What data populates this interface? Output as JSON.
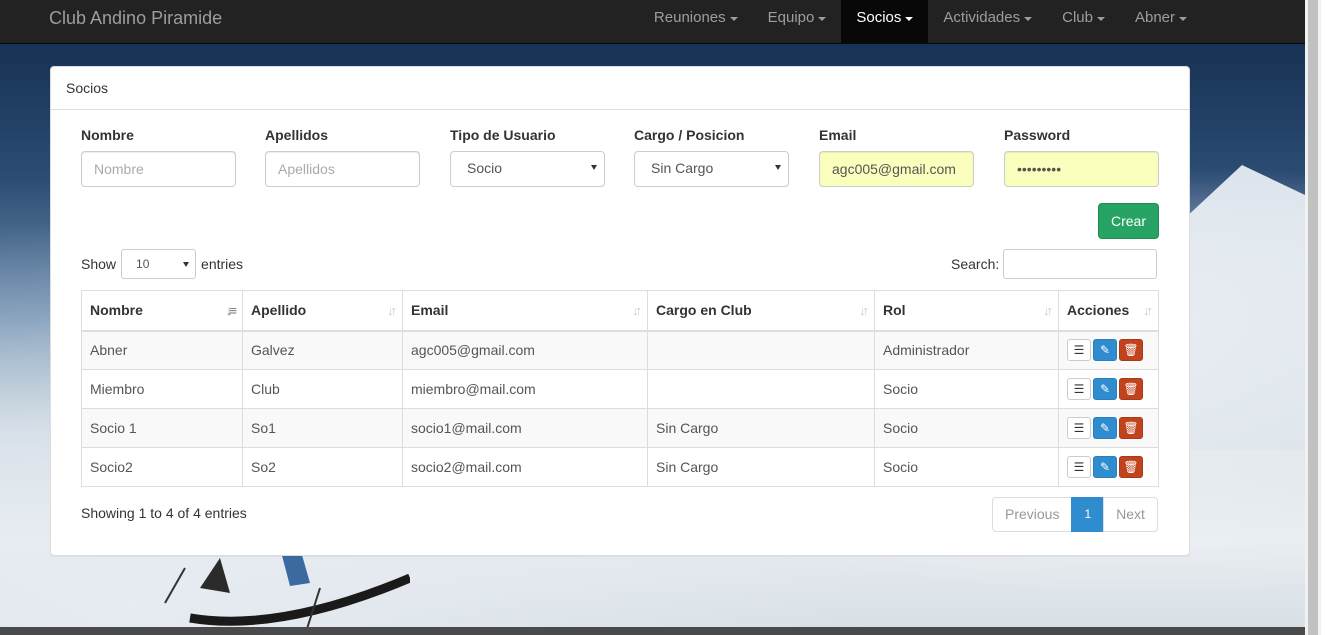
{
  "navbar": {
    "brand": "Club Andino Piramide",
    "items": [
      {
        "label": "Reuniones",
        "active": false
      },
      {
        "label": "Equipo",
        "active": false
      },
      {
        "label": "Socios",
        "active": true
      },
      {
        "label": "Actividades",
        "active": false
      },
      {
        "label": "Club",
        "active": false
      },
      {
        "label": "Abner",
        "active": false
      }
    ]
  },
  "panel": {
    "title": "Socios"
  },
  "form": {
    "nombre": {
      "label": "Nombre",
      "placeholder": "Nombre",
      "value": ""
    },
    "apellidos": {
      "label": "Apellidos",
      "placeholder": "Apellidos",
      "value": ""
    },
    "tipo": {
      "label": "Tipo de Usuario",
      "selected": "Socio"
    },
    "cargo": {
      "label": "Cargo / Posicion",
      "selected": "Sin Cargo"
    },
    "email": {
      "label": "Email",
      "value": "agc005@gmail.com"
    },
    "password": {
      "label": "Password",
      "value": "•••••••••"
    },
    "submit_label": "Crear"
  },
  "table_controls": {
    "show_label": "Show",
    "entries_label": "entries",
    "page_length": "10",
    "search_label": "Search:"
  },
  "table": {
    "columns": [
      "Nombre",
      "Apellido",
      "Email",
      "Cargo en Club",
      "Rol",
      "Acciones"
    ],
    "rows": [
      {
        "nombre": "Abner",
        "apellido": "Galvez",
        "email": "agc005@gmail.com",
        "cargo": "",
        "rol": "Administrador"
      },
      {
        "nombre": "Miembro",
        "apellido": "Club",
        "email": "miembro@mail.com",
        "cargo": "",
        "rol": "Socio"
      },
      {
        "nombre": "Socio 1",
        "apellido": "So1",
        "email": "socio1@mail.com",
        "cargo": "Sin Cargo",
        "rol": "Socio"
      },
      {
        "nombre": "Socio2",
        "apellido": "So2",
        "email": "socio2@mail.com",
        "cargo": "Sin Cargo",
        "rol": "Socio"
      }
    ]
  },
  "footer": {
    "info": "Showing 1 to 4 of 4 entries",
    "previous": "Previous",
    "current_page": "1",
    "next": "Next"
  },
  "colors": {
    "navbar": "#222222",
    "primary": "#2e8ccf",
    "success": "#27a363",
    "danger": "#c1431d",
    "autofill": "#faffbd"
  }
}
